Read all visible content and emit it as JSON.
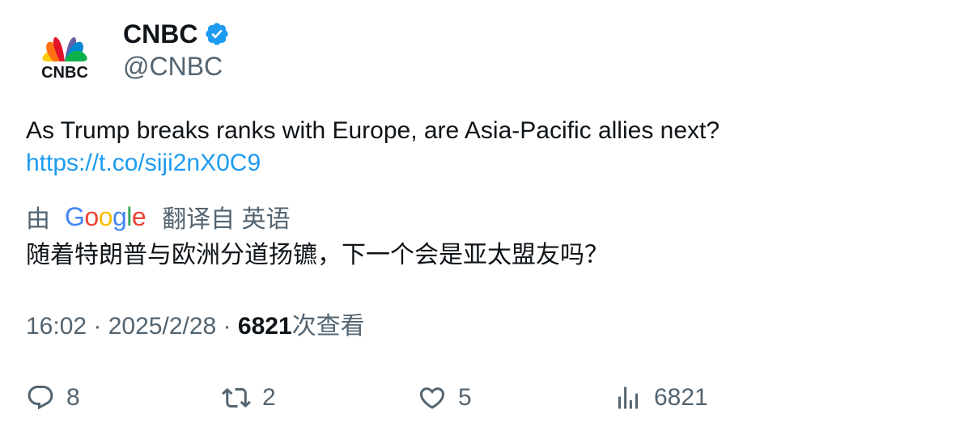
{
  "author": {
    "name": "CNBC",
    "handle": "@CNBC",
    "avatar_logo_text": "CNBC",
    "verified_color": "#1d9bf0"
  },
  "tweet": {
    "text": "As Trump breaks ranks with Europe, are Asia-Pacific allies next?",
    "link": "https://t.co/siji2nX0C9"
  },
  "translation": {
    "prefix": "由",
    "provider": "Google",
    "suffix": "翻译自 英语",
    "text": "随着特朗普与欧洲分道扬镳，下一个会是亚太盟友吗？"
  },
  "meta": {
    "time": "16:02",
    "separator": " · ",
    "date": "2025/2/28",
    "views_count": "6821",
    "views_label": "次查看"
  },
  "actions": {
    "replies": "8",
    "retweets": "2",
    "likes": "5",
    "views": "6821"
  },
  "colors": {
    "link": "#1d9bf0",
    "secondary_text": "#536471",
    "primary_text": "#0f1419"
  }
}
